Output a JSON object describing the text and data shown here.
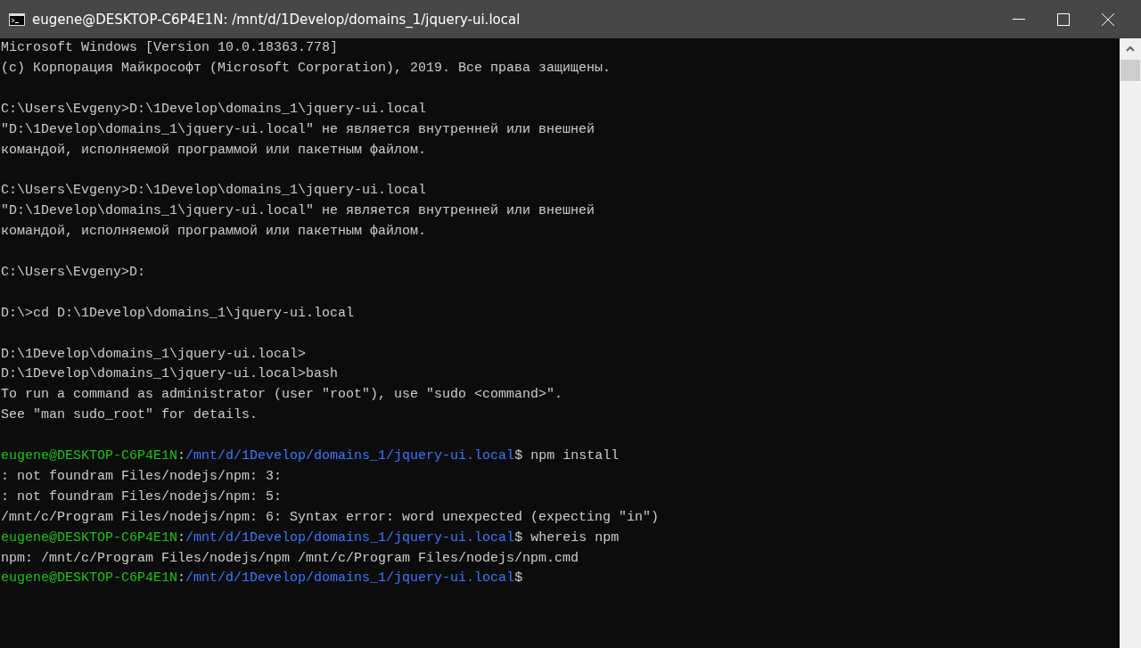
{
  "window": {
    "title": "eugene@DESKTOP-C6P4E1N: /mnt/d/1Develop/domains_1/jquery-ui.local"
  },
  "console": {
    "blocks": [
      {
        "lines": [
          [
            {
              "kind": "plain",
              "text": "Microsoft Windows [Version 10.0.18363.778]"
            }
          ],
          [
            {
              "kind": "plain",
              "text": "(c) Корпорация Майкрософт (Microsoft Corporation), 2019. Все права защищены."
            }
          ]
        ]
      },
      {
        "lines": [
          [
            {
              "kind": "plain",
              "text": "C:\\Users\\Evgeny>D:\\1Develop\\domains_1\\jquery-ui.local"
            }
          ],
          [
            {
              "kind": "plain",
              "text": "\"D:\\1Develop\\domains_1\\jquery-ui.local\" не является внутренней или внешней"
            }
          ],
          [
            {
              "kind": "plain",
              "text": "командой, исполняемой программой или пакетным файлом."
            }
          ]
        ]
      },
      {
        "lines": [
          [
            {
              "kind": "plain",
              "text": "C:\\Users\\Evgeny>D:\\1Develop\\domains_1\\jquery-ui.local"
            }
          ],
          [
            {
              "kind": "plain",
              "text": "\"D:\\1Develop\\domains_1\\jquery-ui.local\" не является внутренней или внешней"
            }
          ],
          [
            {
              "kind": "plain",
              "text": "командой, исполняемой программой или пакетным файлом."
            }
          ]
        ]
      },
      {
        "lines": [
          [
            {
              "kind": "plain",
              "text": "C:\\Users\\Evgeny>D:"
            }
          ]
        ]
      },
      {
        "lines": [
          [
            {
              "kind": "plain",
              "text": "D:\\>cd D:\\1Develop\\domains_1\\jquery-ui.local"
            }
          ]
        ]
      },
      {
        "lines": [
          [
            {
              "kind": "plain",
              "text": "D:\\1Develop\\domains_1\\jquery-ui.local>"
            }
          ],
          [
            {
              "kind": "plain",
              "text": "D:\\1Develop\\domains_1\\jquery-ui.local>bash"
            }
          ],
          [
            {
              "kind": "plain",
              "text": "To run a command as administrator (user \"root\"), use \"sudo <command>\"."
            }
          ],
          [
            {
              "kind": "plain",
              "text": "See \"man sudo_root\" for details."
            }
          ]
        ]
      },
      {
        "lines": [
          [
            {
              "kind": "user",
              "text": "eugene@DESKTOP-C6P4E1N"
            },
            {
              "kind": "plain",
              "text": ":"
            },
            {
              "kind": "path",
              "text": "/mnt/d/1Develop/domains_1/jquery-ui.local"
            },
            {
              "kind": "plain",
              "text": "$ npm install"
            }
          ],
          [
            {
              "kind": "plain",
              "text": ": not foundram Files/nodejs/npm: 3:"
            }
          ],
          [
            {
              "kind": "plain",
              "text": ": not foundram Files/nodejs/npm: 5:"
            }
          ],
          [
            {
              "kind": "plain",
              "text": "/mnt/c/Program Files/nodejs/npm: 6: Syntax error: word unexpected (expecting \"in\")"
            }
          ],
          [
            {
              "kind": "user",
              "text": "eugene@DESKTOP-C6P4E1N"
            },
            {
              "kind": "plain",
              "text": ":"
            },
            {
              "kind": "path",
              "text": "/mnt/d/1Develop/domains_1/jquery-ui.local"
            },
            {
              "kind": "plain",
              "text": "$ whereis npm"
            }
          ],
          [
            {
              "kind": "plain",
              "text": "npm: /mnt/c/Program Files/nodejs/npm /mnt/c/Program Files/nodejs/npm.cmd"
            }
          ],
          [
            {
              "kind": "user",
              "text": "eugene@DESKTOP-C6P4E1N"
            },
            {
              "kind": "plain",
              "text": ":"
            },
            {
              "kind": "path",
              "text": "/mnt/d/1Develop/domains_1/jquery-ui.local"
            },
            {
              "kind": "plain",
              "text": "$"
            }
          ]
        ]
      }
    ]
  }
}
